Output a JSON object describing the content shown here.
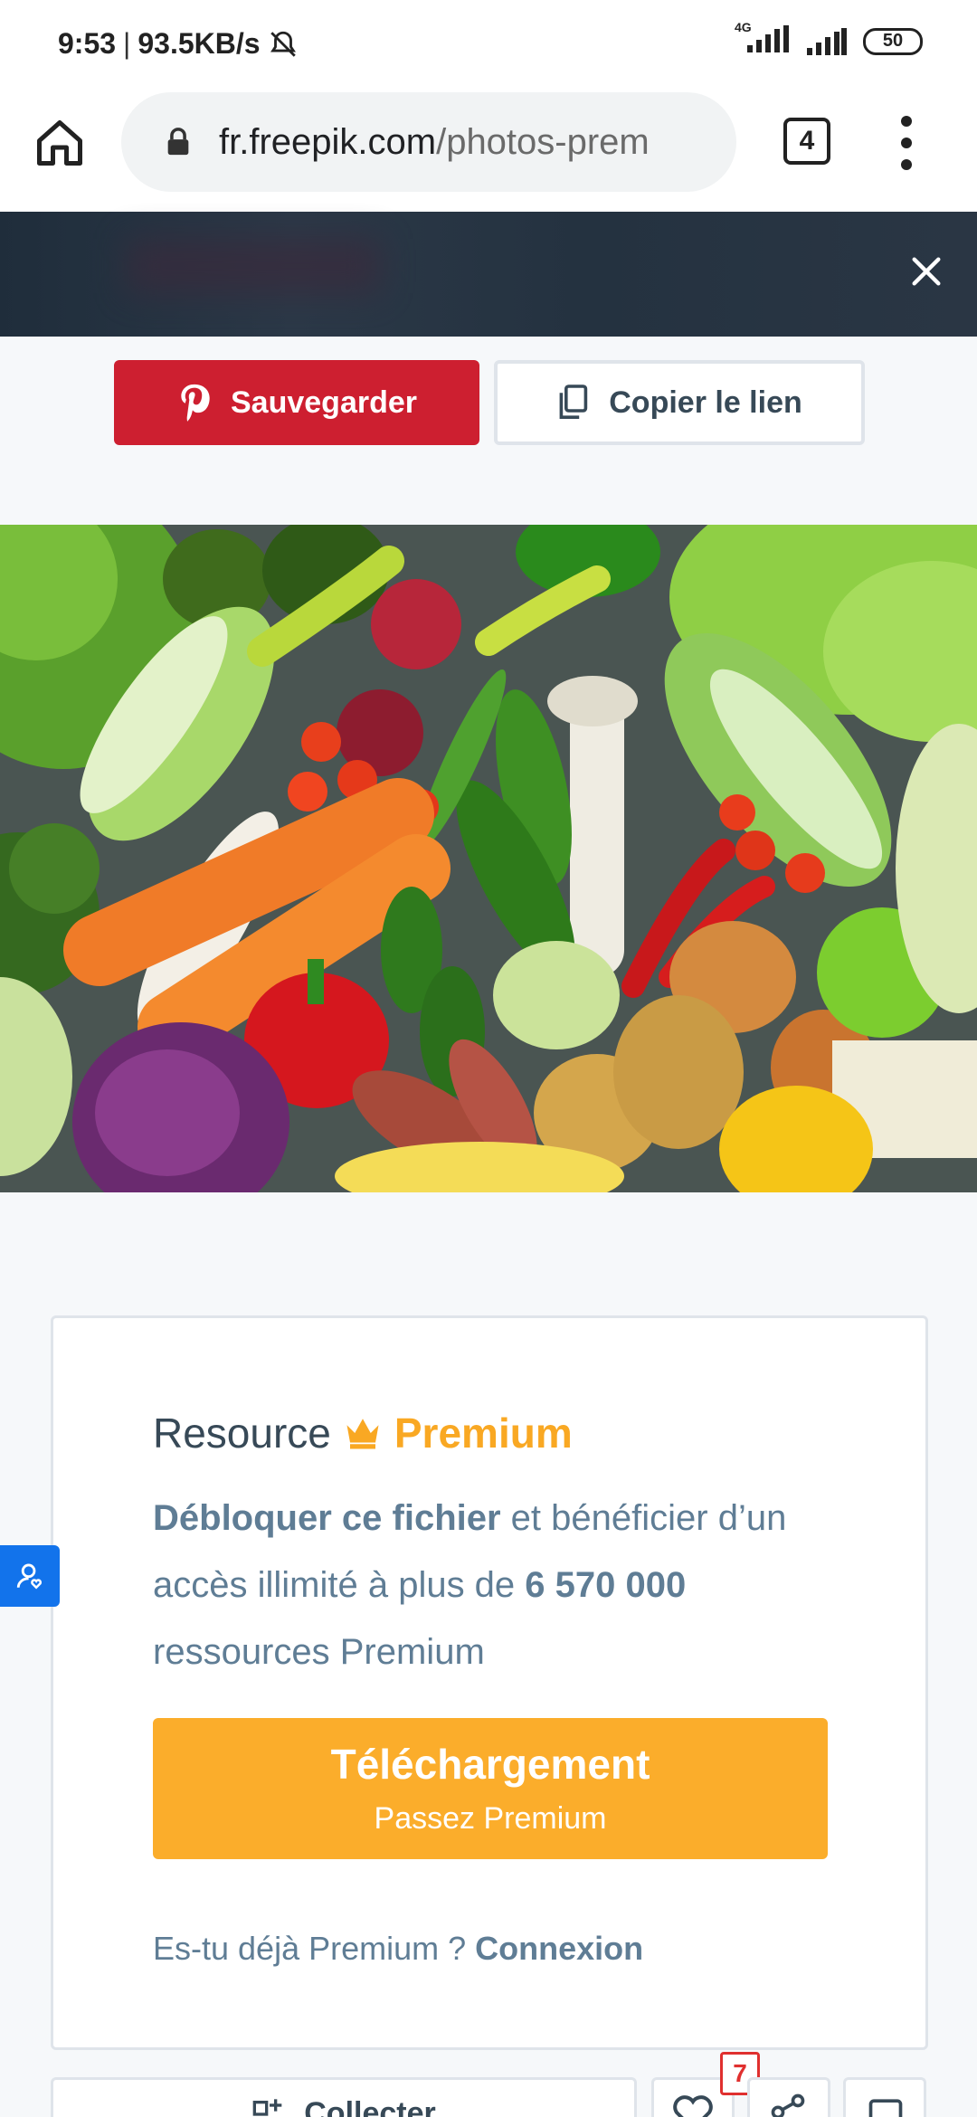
{
  "status_bar": {
    "time": "9:53",
    "speed": "93.5KB/s",
    "network_type": "4G",
    "battery": "50"
  },
  "browser": {
    "url_domain": "fr.freepik.com",
    "url_path": "/photos-prem",
    "tab_count": "4"
  },
  "share": {
    "pinterest_label": "Sauvegarder",
    "copy_label": "Copier le lien"
  },
  "premium_card": {
    "title_prefix": "Resource",
    "title_badge": "Premium",
    "desc_bold_1": "Débloquer ce fichier",
    "desc_text_1": " et bénéficier d’un accès illimité à plus de ",
    "desc_bold_2": "6 570 000",
    "desc_text_2": " ressources Premium",
    "download_title": "Téléchargement",
    "download_sub": "Passez Premium",
    "login_question": "Es-tu déjà Premium ? ",
    "login_link": "Connexion"
  },
  "bottom_actions": {
    "collect_label": "Collecter",
    "likes_badge": "7"
  },
  "colors": {
    "pinterest_red": "#cd1f30",
    "premium_orange": "#f9a823",
    "download_button": "#fbad2b",
    "feedback_blue": "#1273eb",
    "banner_dark": "#243240"
  }
}
